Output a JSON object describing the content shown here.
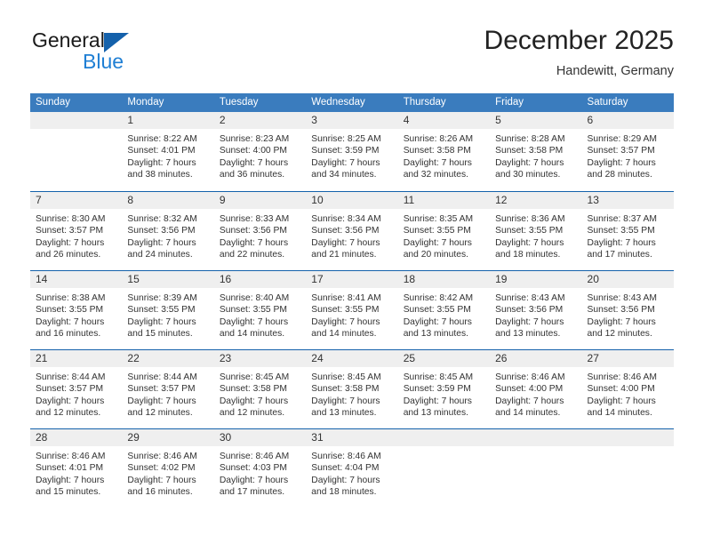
{
  "logo": {
    "text_primary": "General",
    "text_secondary": "Blue",
    "triangle_color": "#1461ab",
    "secondary_color": "#1f7fd4"
  },
  "header": {
    "title": "December 2025",
    "subtitle": "Handewitt, Germany"
  },
  "theme": {
    "header_bg": "#3a7cbe",
    "week_divider": "#1461ab",
    "day_band_bg": "#efefef",
    "text": "#333333"
  },
  "weekdays": [
    "Sunday",
    "Monday",
    "Tuesday",
    "Wednesday",
    "Thursday",
    "Friday",
    "Saturday"
  ],
  "weeks": [
    [
      {
        "day": "",
        "lines": []
      },
      {
        "day": "1",
        "lines": [
          "Sunrise: 8:22 AM",
          "Sunset: 4:01 PM",
          "Daylight: 7 hours",
          "and 38 minutes."
        ]
      },
      {
        "day": "2",
        "lines": [
          "Sunrise: 8:23 AM",
          "Sunset: 4:00 PM",
          "Daylight: 7 hours",
          "and 36 minutes."
        ]
      },
      {
        "day": "3",
        "lines": [
          "Sunrise: 8:25 AM",
          "Sunset: 3:59 PM",
          "Daylight: 7 hours",
          "and 34 minutes."
        ]
      },
      {
        "day": "4",
        "lines": [
          "Sunrise: 8:26 AM",
          "Sunset: 3:58 PM",
          "Daylight: 7 hours",
          "and 32 minutes."
        ]
      },
      {
        "day": "5",
        "lines": [
          "Sunrise: 8:28 AM",
          "Sunset: 3:58 PM",
          "Daylight: 7 hours",
          "and 30 minutes."
        ]
      },
      {
        "day": "6",
        "lines": [
          "Sunrise: 8:29 AM",
          "Sunset: 3:57 PM",
          "Daylight: 7 hours",
          "and 28 minutes."
        ]
      }
    ],
    [
      {
        "day": "7",
        "lines": [
          "Sunrise: 8:30 AM",
          "Sunset: 3:57 PM",
          "Daylight: 7 hours",
          "and 26 minutes."
        ]
      },
      {
        "day": "8",
        "lines": [
          "Sunrise: 8:32 AM",
          "Sunset: 3:56 PM",
          "Daylight: 7 hours",
          "and 24 minutes."
        ]
      },
      {
        "day": "9",
        "lines": [
          "Sunrise: 8:33 AM",
          "Sunset: 3:56 PM",
          "Daylight: 7 hours",
          "and 22 minutes."
        ]
      },
      {
        "day": "10",
        "lines": [
          "Sunrise: 8:34 AM",
          "Sunset: 3:56 PM",
          "Daylight: 7 hours",
          "and 21 minutes."
        ]
      },
      {
        "day": "11",
        "lines": [
          "Sunrise: 8:35 AM",
          "Sunset: 3:55 PM",
          "Daylight: 7 hours",
          "and 20 minutes."
        ]
      },
      {
        "day": "12",
        "lines": [
          "Sunrise: 8:36 AM",
          "Sunset: 3:55 PM",
          "Daylight: 7 hours",
          "and 18 minutes."
        ]
      },
      {
        "day": "13",
        "lines": [
          "Sunrise: 8:37 AM",
          "Sunset: 3:55 PM",
          "Daylight: 7 hours",
          "and 17 minutes."
        ]
      }
    ],
    [
      {
        "day": "14",
        "lines": [
          "Sunrise: 8:38 AM",
          "Sunset: 3:55 PM",
          "Daylight: 7 hours",
          "and 16 minutes."
        ]
      },
      {
        "day": "15",
        "lines": [
          "Sunrise: 8:39 AM",
          "Sunset: 3:55 PM",
          "Daylight: 7 hours",
          "and 15 minutes."
        ]
      },
      {
        "day": "16",
        "lines": [
          "Sunrise: 8:40 AM",
          "Sunset: 3:55 PM",
          "Daylight: 7 hours",
          "and 14 minutes."
        ]
      },
      {
        "day": "17",
        "lines": [
          "Sunrise: 8:41 AM",
          "Sunset: 3:55 PM",
          "Daylight: 7 hours",
          "and 14 minutes."
        ]
      },
      {
        "day": "18",
        "lines": [
          "Sunrise: 8:42 AM",
          "Sunset: 3:55 PM",
          "Daylight: 7 hours",
          "and 13 minutes."
        ]
      },
      {
        "day": "19",
        "lines": [
          "Sunrise: 8:43 AM",
          "Sunset: 3:56 PM",
          "Daylight: 7 hours",
          "and 13 minutes."
        ]
      },
      {
        "day": "20",
        "lines": [
          "Sunrise: 8:43 AM",
          "Sunset: 3:56 PM",
          "Daylight: 7 hours",
          "and 12 minutes."
        ]
      }
    ],
    [
      {
        "day": "21",
        "lines": [
          "Sunrise: 8:44 AM",
          "Sunset: 3:57 PM",
          "Daylight: 7 hours",
          "and 12 minutes."
        ]
      },
      {
        "day": "22",
        "lines": [
          "Sunrise: 8:44 AM",
          "Sunset: 3:57 PM",
          "Daylight: 7 hours",
          "and 12 minutes."
        ]
      },
      {
        "day": "23",
        "lines": [
          "Sunrise: 8:45 AM",
          "Sunset: 3:58 PM",
          "Daylight: 7 hours",
          "and 12 minutes."
        ]
      },
      {
        "day": "24",
        "lines": [
          "Sunrise: 8:45 AM",
          "Sunset: 3:58 PM",
          "Daylight: 7 hours",
          "and 13 minutes."
        ]
      },
      {
        "day": "25",
        "lines": [
          "Sunrise: 8:45 AM",
          "Sunset: 3:59 PM",
          "Daylight: 7 hours",
          "and 13 minutes."
        ]
      },
      {
        "day": "26",
        "lines": [
          "Sunrise: 8:46 AM",
          "Sunset: 4:00 PM",
          "Daylight: 7 hours",
          "and 14 minutes."
        ]
      },
      {
        "day": "27",
        "lines": [
          "Sunrise: 8:46 AM",
          "Sunset: 4:00 PM",
          "Daylight: 7 hours",
          "and 14 minutes."
        ]
      }
    ],
    [
      {
        "day": "28",
        "lines": [
          "Sunrise: 8:46 AM",
          "Sunset: 4:01 PM",
          "Daylight: 7 hours",
          "and 15 minutes."
        ]
      },
      {
        "day": "29",
        "lines": [
          "Sunrise: 8:46 AM",
          "Sunset: 4:02 PM",
          "Daylight: 7 hours",
          "and 16 minutes."
        ]
      },
      {
        "day": "30",
        "lines": [
          "Sunrise: 8:46 AM",
          "Sunset: 4:03 PM",
          "Daylight: 7 hours",
          "and 17 minutes."
        ]
      },
      {
        "day": "31",
        "lines": [
          "Sunrise: 8:46 AM",
          "Sunset: 4:04 PM",
          "Daylight: 7 hours",
          "and 18 minutes."
        ]
      },
      {
        "day": "",
        "lines": []
      },
      {
        "day": "",
        "lines": []
      },
      {
        "day": "",
        "lines": []
      }
    ]
  ]
}
